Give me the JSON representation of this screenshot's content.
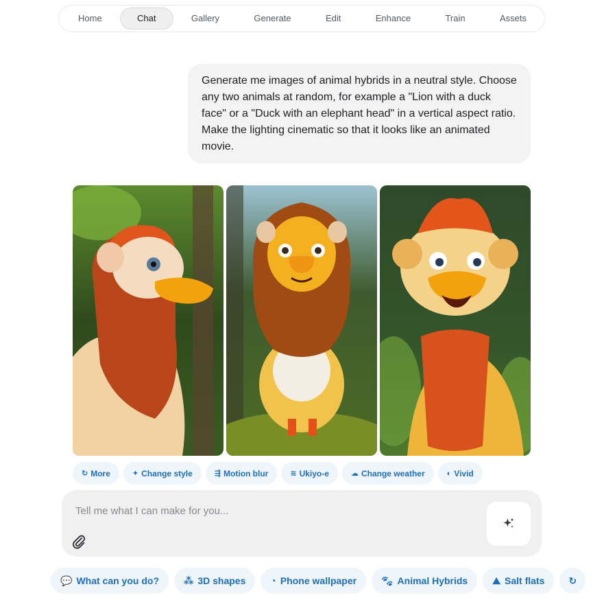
{
  "nav": {
    "items": [
      {
        "label": "Home"
      },
      {
        "label": "Chat",
        "active": true
      },
      {
        "label": "Gallery"
      },
      {
        "label": "Generate"
      },
      {
        "label": "Edit"
      },
      {
        "label": "Enhance"
      },
      {
        "label": "Train"
      },
      {
        "label": "Assets"
      }
    ]
  },
  "message": {
    "line1": "Generate me images of animal hybrids in a neutral style. Choose",
    "line2": "any two animals at random, for example a \"Lion with a duck",
    "line3": "face\" or a \"Duck with an elephant head\" in a vertical aspect ratio.",
    "line4": "Make the lighting cinematic so that it looks like an animated",
    "line5": "movie."
  },
  "images": [
    {
      "subject": "lion-duck hybrid side profile",
      "icon": "generated-image"
    },
    {
      "subject": "lion-duck hybrid standing front",
      "icon": "generated-image"
    },
    {
      "subject": "lion-duck hybrid smiling",
      "icon": "generated-image"
    }
  ],
  "actions": {
    "more": "More",
    "change_style": "Change style",
    "motion_blur": "Motion blur",
    "ukiyo_e": "Ukiyo-e",
    "change_weather": "Change weather",
    "vivid": "Vivid"
  },
  "composer": {
    "placeholder": "Tell me what I can make for you..."
  },
  "suggestions": {
    "what_can_you_do": "What can you do?",
    "shapes_3d": "3D shapes",
    "phone_wallpaper": "Phone wallpaper",
    "animal_hybrids": "Animal Hybrids",
    "salt_flats": "Salt flats"
  },
  "colors": {
    "accent": "#1f6fb8",
    "chip_bg": "#eef5fb",
    "bubble_bg": "#f3f3f4"
  }
}
